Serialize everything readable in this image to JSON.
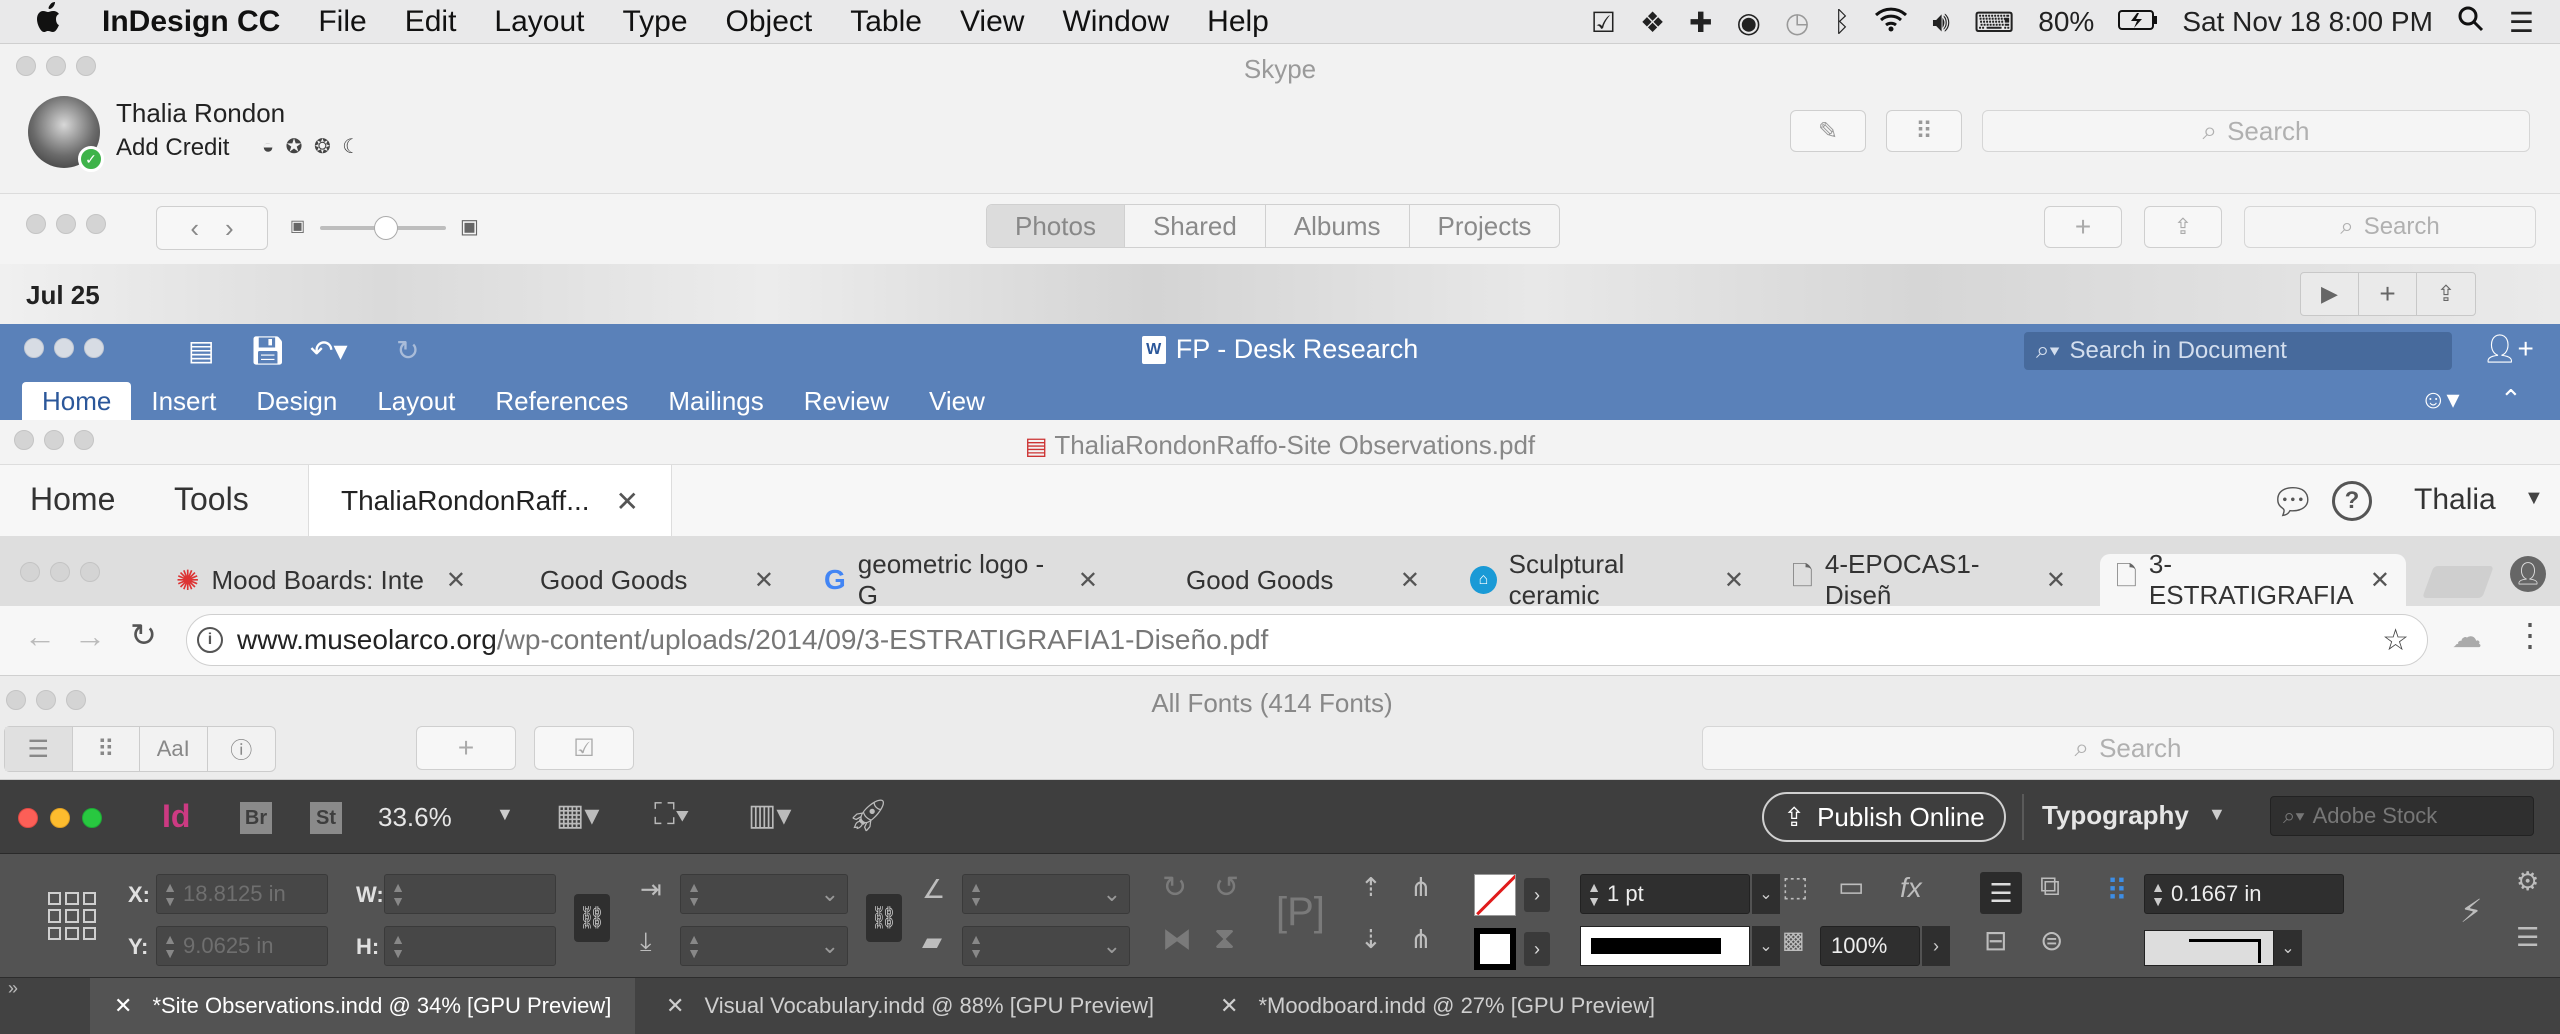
{
  "menubar": {
    "app_name": "InDesign CC",
    "menus": [
      "File",
      "Edit",
      "Layout",
      "Type",
      "Object",
      "Table",
      "View",
      "Window",
      "Help"
    ],
    "battery": "80%",
    "datetime": "Sat Nov 18  8:00 PM"
  },
  "skype": {
    "title": "Skype",
    "user_name": "Thalia Rondon",
    "add_credit": "Add Credit",
    "mood_icons": "◒ ✪ ❂ ☾",
    "search_placeholder": "Search"
  },
  "photos": {
    "segments": [
      "Photos",
      "Shared",
      "Albums",
      "Projects"
    ],
    "search_placeholder": "Search",
    "date": "Jul 25"
  },
  "word": {
    "title": "FP - Desk Research",
    "search_placeholder": "Search in Document",
    "tabs": [
      "Home",
      "Insert",
      "Design",
      "Layout",
      "References",
      "Mailings",
      "Review",
      "View"
    ]
  },
  "acrobat": {
    "title": "ThaliaRondonRaffo-Site Observations.pdf",
    "nav_home": "Home",
    "nav_tools": "Tools",
    "doc_tab": "ThaliaRondonRaff...",
    "user": "Thalia"
  },
  "chrome": {
    "tabs": [
      {
        "label": "Mood Boards: Inte"
      },
      {
        "label": "Good Goods"
      },
      {
        "label": "geometric logo - G"
      },
      {
        "label": "Good Goods"
      },
      {
        "label": "Sculptural ceramic"
      },
      {
        "label": "4-EPOCAS1-Diseñ"
      },
      {
        "label": "3-ESTRATIGRAFIA"
      }
    ],
    "url_domain": "www.museolarco.org",
    "url_path": "/wp-content/uploads/2014/09/3-ESTRATIGRAFIA1-Diseño.pdf"
  },
  "fontbook": {
    "title": "All Fonts (414 Fonts)",
    "size_button": "AaI",
    "search_placeholder": "Search"
  },
  "indesign": {
    "zoom": "33.6%",
    "publish_label": "Publish Online",
    "workspace": "Typography",
    "stock_placeholder": "Adobe Stock",
    "x_label": "X:",
    "y_label": "Y:",
    "w_label": "W:",
    "h_label": "H:",
    "x_value": "18.8125 in",
    "y_value": "9.0625 in",
    "stroke_weight": "1 pt",
    "opacity": "100%",
    "gutter": "0.1667 in",
    "br_label": "Br",
    "st_label": "St",
    "doc_tabs": [
      {
        "label": "*Site Observations.indd @ 34% [GPU Preview]"
      },
      {
        "label": "Visual Vocabulary.indd @ 88% [GPU Preview]"
      },
      {
        "label": "*Moodboard.indd @ 27% [GPU Preview]"
      }
    ]
  }
}
